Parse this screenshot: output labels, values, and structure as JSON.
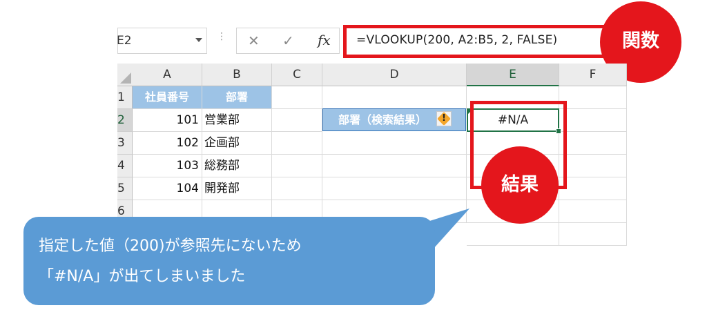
{
  "formula_bar": {
    "name_box": "E2",
    "cancel_symbol": "✕",
    "enter_symbol": "✓",
    "fx_label": "fx",
    "formula": "=VLOOKUP(200, A2:B5, 2, FALSE)"
  },
  "columns": [
    "A",
    "B",
    "C",
    "D",
    "E",
    "F"
  ],
  "rows": [
    "1",
    "2",
    "3",
    "4",
    "5",
    "6"
  ],
  "table": {
    "headers": [
      "社員番号",
      "部署"
    ],
    "rows": [
      {
        "id": "101",
        "dept": "営業部"
      },
      {
        "id": "102",
        "dept": "企画部"
      },
      {
        "id": "103",
        "dept": "総務部"
      },
      {
        "id": "104",
        "dept": "開発部"
      }
    ]
  },
  "lookup": {
    "label": "部署（検索結果）",
    "result": "#N/A",
    "warning_symbol": "!"
  },
  "annotations": {
    "function_badge": "関数",
    "result_badge": "結果",
    "callout_line1": "指定した値（200)が参照先にないため",
    "callout_line2": "「#N/A」が出てしまいました"
  },
  "colors": {
    "highlight_red": "#e4161c",
    "header_fill": "#9dc3e6",
    "callout_blue": "#5b9bd5",
    "excel_green": "#217346",
    "warning_orange": "#f4a62a"
  }
}
